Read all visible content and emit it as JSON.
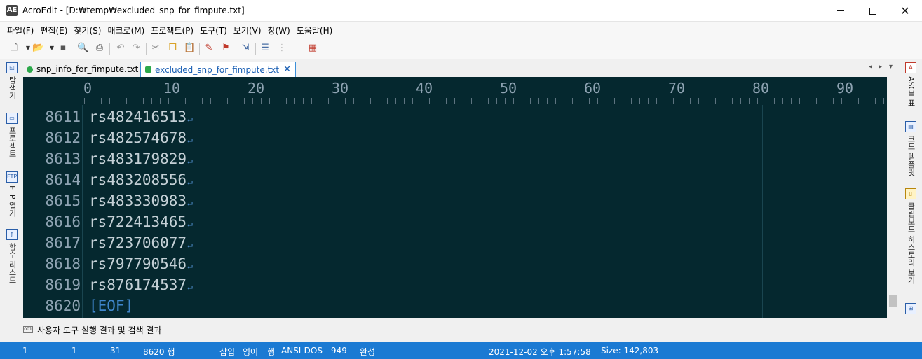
{
  "window": {
    "app_icon": "AE",
    "title": "AcroEdit - [D:₩temp₩excluded_snp_for_fimpute.txt]"
  },
  "menu": [
    "파일(F)",
    "편집(E)",
    "찾기(S)",
    "매크로(M)",
    "프로젝트(P)",
    "도구(T)",
    "보기(V)",
    "창(W)",
    "도움말(H)"
  ],
  "left_sidebar": [
    {
      "label": "탐색기",
      "icon": "explorer-icon"
    },
    {
      "label": "프로젝트",
      "icon": "project-icon"
    },
    {
      "label": "FTP 열기",
      "icon": "ftp-icon",
      "icon_text": "FTP"
    },
    {
      "label": "함수 리스트",
      "icon": "function-list-icon"
    }
  ],
  "right_sidebar": [
    {
      "label": "ASCII 표",
      "icon": "ascii-icon",
      "icon_text": "A"
    },
    {
      "label": "코드 템플릿",
      "icon": "template-icon"
    },
    {
      "label": "클립보드 히스토리 보기",
      "icon": "clipboard-icon"
    }
  ],
  "tabs": [
    {
      "label": "snp_info_for_fimpute.txt",
      "color": "#2ca84a"
    },
    {
      "label": "excluded_snp_for_fimpute.txt",
      "color": "#2ca84a"
    }
  ],
  "ruler": [
    "0",
    "10",
    "20",
    "30",
    "40",
    "50",
    "60",
    "70",
    "80",
    "90"
  ],
  "lines": [
    {
      "num": "8611",
      "text": "rs482416513"
    },
    {
      "num": "8612",
      "text": "rs482574678"
    },
    {
      "num": "8613",
      "text": "rs483179829"
    },
    {
      "num": "8614",
      "text": "rs483208556"
    },
    {
      "num": "8615",
      "text": "rs483330983"
    },
    {
      "num": "8616",
      "text": "rs722413465"
    },
    {
      "num": "8617",
      "text": "rs723706077"
    },
    {
      "num": "8618",
      "text": "rs797790546"
    },
    {
      "num": "8619",
      "text": "rs876174537"
    },
    {
      "num": "8620",
      "text": "[EOF]"
    }
  ],
  "eol_mark": "↵",
  "output_panel": {
    "label": "사용자 도구 실행 결과 및 검색 결과",
    "icon_text": "001"
  },
  "status": {
    "col1": "1",
    "col2": "1",
    "col3": "31",
    "lines": "8620 행",
    "insert": "삽입",
    "lang": "영어",
    "mode": "행",
    "encoding": "ANSI-DOS - 949",
    "state": "완성",
    "datetime": "2021-12-02 오후 1:57:58",
    "size": "Size: 142,803"
  },
  "colors": {
    "editor_bg": "#05282f",
    "statusbar_bg": "#1b7ad3",
    "eof": "#3f86cc"
  }
}
